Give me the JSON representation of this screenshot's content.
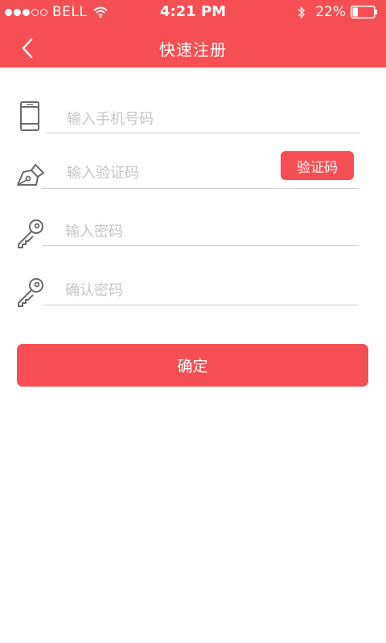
{
  "status_bar": {
    "carrier": "BELL",
    "time": "4:21 PM",
    "battery": "22%",
    "signal_bars": 5,
    "signal_filled": 3
  },
  "header": {
    "title": "快速注册",
    "back_icon": "chevron-left-icon",
    "background_color": "#f64f53"
  },
  "form": {
    "phone": {
      "placeholder": "输入手机号码",
      "value": "",
      "icon": "phone-icon"
    },
    "verification_code": {
      "placeholder": "输入验证码",
      "value": "",
      "icon": "pen-icon",
      "button_label": "验证码"
    },
    "password": {
      "placeholder": "输入密码",
      "value": "",
      "icon": "key-icon"
    },
    "confirm_password": {
      "placeholder": "确认密码",
      "value": "",
      "icon": "key-icon"
    }
  },
  "actions": {
    "confirm_label": "确定",
    "accent_color": "#f64f53"
  }
}
